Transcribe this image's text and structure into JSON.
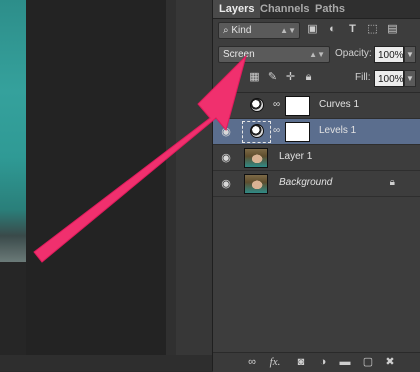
{
  "tabs": [
    {
      "label": "Layers",
      "active": true
    },
    {
      "label": "Channels",
      "active": false
    },
    {
      "label": "Paths",
      "active": false
    }
  ],
  "filter": {
    "kind_label": "Kind",
    "icons": [
      "image-filter-icon",
      "adjustment-filter-icon",
      "type-filter-icon",
      "shape-filter-icon",
      "smart-object-filter-icon"
    ]
  },
  "blend": {
    "mode": "Screen",
    "opacity_label": "Opacity:",
    "opacity_value": "100%",
    "fill_label": "Fill:",
    "fill_value": "100%"
  },
  "locks": [
    "lock-transparent-icon",
    "lock-pixels-icon",
    "lock-position-icon",
    "lock-all-icon"
  ],
  "layers": [
    {
      "name": "Curves 1",
      "type": "adjustment",
      "visible": false,
      "selected": false
    },
    {
      "name": "Levels 1",
      "type": "adjustment",
      "visible": true,
      "selected": true
    },
    {
      "name": "Layer 1",
      "type": "pixel",
      "visible": true,
      "selected": false
    },
    {
      "name": "Background",
      "type": "pixel",
      "visible": true,
      "selected": false,
      "locked": true
    }
  ],
  "footer_icons": [
    "link-layers-icon",
    "fx-icon",
    "add-mask-icon",
    "new-adjustment-icon",
    "new-group-icon",
    "new-layer-icon",
    "delete-layer-icon"
  ],
  "colors": {
    "arrow": "#f0306e",
    "selection": "#5b6e8e"
  }
}
